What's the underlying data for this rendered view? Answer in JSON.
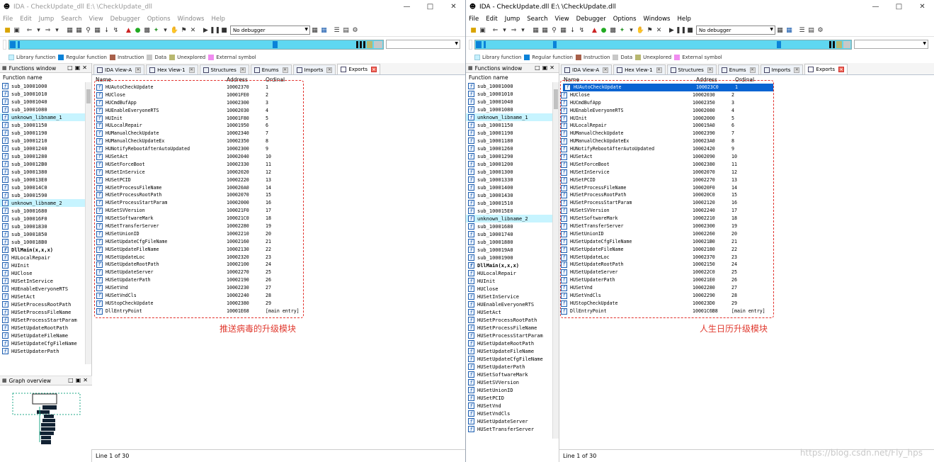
{
  "winA": {
    "title": "IDA - CheckUpdate_dll E:\\        \\CheckUpdate_dll",
    "menu": [
      "File",
      "Edit",
      "Jump",
      "Search",
      "View",
      "Debugger",
      "Options",
      "Windows",
      "Help"
    ],
    "debugger_select": "No debugger",
    "legend": [
      "Library function",
      "Regular function",
      "Instruction",
      "Data",
      "Unexplored",
      "External symbol"
    ],
    "functions_panel_title": "Functions window",
    "functions_header": "Function name",
    "functions": [
      {
        "name": "sub_10001000",
        "kind": "normal"
      },
      {
        "name": "sub_10001010",
        "kind": "normal"
      },
      {
        "name": "sub_10001040",
        "kind": "normal"
      },
      {
        "name": "sub_10001080",
        "kind": "normal"
      },
      {
        "name": "unknown_libname_1",
        "kind": "lib"
      },
      {
        "name": "sub_10001150",
        "kind": "normal"
      },
      {
        "name": "sub_10001190",
        "kind": "normal"
      },
      {
        "name": "sub_10001210",
        "kind": "normal"
      },
      {
        "name": "sub_10001240",
        "kind": "normal"
      },
      {
        "name": "sub_10001280",
        "kind": "normal"
      },
      {
        "name": "sub_100012B0",
        "kind": "normal"
      },
      {
        "name": "sub_10001380",
        "kind": "normal"
      },
      {
        "name": "sub_100013E0",
        "kind": "normal"
      },
      {
        "name": "sub_100014C0",
        "kind": "normal"
      },
      {
        "name": "sub_10001590",
        "kind": "normal"
      },
      {
        "name": "unknown_libname_2",
        "kind": "lib"
      },
      {
        "name": "sub_10001680",
        "kind": "normal"
      },
      {
        "name": "sub_100016F0",
        "kind": "normal"
      },
      {
        "name": "sub_10001830",
        "kind": "normal"
      },
      {
        "name": "sub_10001850",
        "kind": "normal"
      },
      {
        "name": "sub_100018B0",
        "kind": "normal"
      },
      {
        "name": "DllMain(x,x,x)",
        "kind": "bold"
      },
      {
        "name": "HULocalRepair",
        "kind": "normal"
      },
      {
        "name": "HUInit",
        "kind": "normal"
      },
      {
        "name": "HUClose",
        "kind": "normal"
      },
      {
        "name": "HUSetInService",
        "kind": "normal"
      },
      {
        "name": "HUEnableEveryoneRTS",
        "kind": "normal"
      },
      {
        "name": "HUSetAct",
        "kind": "normal"
      },
      {
        "name": "HUSetProcessRootPath",
        "kind": "normal"
      },
      {
        "name": "HUSetProcessFileName",
        "kind": "normal"
      },
      {
        "name": "HUSetProcessStartParam",
        "kind": "normal"
      },
      {
        "name": "HUSetUpdateRootPath",
        "kind": "normal"
      },
      {
        "name": "HUSetUpdateFileName",
        "kind": "normal"
      },
      {
        "name": "HUSetUpdateCfgFileName",
        "kind": "normal"
      },
      {
        "name": "HUSetUpdaterPath",
        "kind": "normal"
      }
    ],
    "graph_panel_title": "Graph overview",
    "tabs": [
      {
        "label": "IDA View-A",
        "active": false
      },
      {
        "label": "Hex View-1",
        "active": false
      },
      {
        "label": "Structures",
        "active": false
      },
      {
        "label": "Enums",
        "active": false
      },
      {
        "label": "Imports",
        "active": false
      },
      {
        "label": "Exports",
        "active": true
      }
    ],
    "exports_headers": {
      "name": "Name",
      "address": "Address",
      "ordinal": "Ordinal"
    },
    "exports": [
      {
        "name": "HUAutoCheckUpdate",
        "address": "10002370",
        "ordinal": "1"
      },
      {
        "name": "HUClose",
        "address": "10001FE0",
        "ordinal": "2"
      },
      {
        "name": "HUCmdBufApp",
        "address": "10002300",
        "ordinal": "3"
      },
      {
        "name": "HUEnableEveryoneRTS",
        "address": "10002030",
        "ordinal": "4"
      },
      {
        "name": "HUInit",
        "address": "10001F80",
        "ordinal": "5"
      },
      {
        "name": "HULocalRepair",
        "address": "10001950",
        "ordinal": "6"
      },
      {
        "name": "HUManualCheckUpdate",
        "address": "10002340",
        "ordinal": "7"
      },
      {
        "name": "HUManualCheckUpdateEx",
        "address": "10002350",
        "ordinal": "8"
      },
      {
        "name": "HUNotifyRebootAfterAutoUpdated",
        "address": "10002300",
        "ordinal": "9"
      },
      {
        "name": "HUSetAct",
        "address": "10002040",
        "ordinal": "10"
      },
      {
        "name": "HUSetForceBoot",
        "address": "10002330",
        "ordinal": "11"
      },
      {
        "name": "HUSetInService",
        "address": "10002020",
        "ordinal": "12"
      },
      {
        "name": "HUSetPCID",
        "address": "10002220",
        "ordinal": "13"
      },
      {
        "name": "HUSetProcessFileName",
        "address": "100020A0",
        "ordinal": "14"
      },
      {
        "name": "HUSetProcessRootPath",
        "address": "10002070",
        "ordinal": "15"
      },
      {
        "name": "HUSetProcessStartParam",
        "address": "10002000",
        "ordinal": "16"
      },
      {
        "name": "HUSetSVVersion",
        "address": "100021F0",
        "ordinal": "17"
      },
      {
        "name": "HUSetSoftwareMark",
        "address": "100021C0",
        "ordinal": "18"
      },
      {
        "name": "HUSetTransferServer",
        "address": "10002280",
        "ordinal": "19"
      },
      {
        "name": "HUSetUnionID",
        "address": "10002210",
        "ordinal": "20"
      },
      {
        "name": "HUSetUpdateCfgFileName",
        "address": "10002160",
        "ordinal": "21"
      },
      {
        "name": "HUSetUpdateFileName",
        "address": "10002130",
        "ordinal": "22"
      },
      {
        "name": "HUSetUpdateLoc",
        "address": "10002320",
        "ordinal": "23"
      },
      {
        "name": "HUSetUpdateRootPath",
        "address": "10002100",
        "ordinal": "24"
      },
      {
        "name": "HUSetUpdateServer",
        "address": "10002270",
        "ordinal": "25"
      },
      {
        "name": "HUSetUpdaterPath",
        "address": "10002190",
        "ordinal": "26"
      },
      {
        "name": "HUSetVnd",
        "address": "10002230",
        "ordinal": "27"
      },
      {
        "name": "HUSetVndCls",
        "address": "10002240",
        "ordinal": "28"
      },
      {
        "name": "HUStopCheckUpdate",
        "address": "10002380",
        "ordinal": "29"
      },
      {
        "name": "DllEntryPoint",
        "address": "10001E68",
        "ordinal": "[main entry]"
      }
    ],
    "annotation": "推送病毒的升级模块",
    "status": "Line 1 of 30"
  },
  "winB": {
    "title": "IDA - CheckUpdate.dll E:\\        \\CheckUpdate.dll",
    "menu": [
      "File",
      "Edit",
      "Jump",
      "Search",
      "View",
      "Debugger",
      "Options",
      "Windows",
      "Help"
    ],
    "debugger_select": "No debugger",
    "legend": [
      "Library function",
      "Regular function",
      "Instruction",
      "Data",
      "Unexplored",
      "External symbol"
    ],
    "functions_panel_title": "Functions window",
    "functions_header": "Function name",
    "functions": [
      {
        "name": "sub_10001000",
        "kind": "normal"
      },
      {
        "name": "sub_10001010",
        "kind": "normal"
      },
      {
        "name": "sub_10001040",
        "kind": "normal"
      },
      {
        "name": "sub_10001080",
        "kind": "normal"
      },
      {
        "name": "unknown_libname_1",
        "kind": "lib"
      },
      {
        "name": "sub_10001150",
        "kind": "normal"
      },
      {
        "name": "sub_10001190",
        "kind": "normal"
      },
      {
        "name": "sub_10001180",
        "kind": "normal"
      },
      {
        "name": "sub_10001260",
        "kind": "normal"
      },
      {
        "name": "sub_10001290",
        "kind": "normal"
      },
      {
        "name": "sub_10001200",
        "kind": "normal"
      },
      {
        "name": "sub_10001300",
        "kind": "normal"
      },
      {
        "name": "sub_10001330",
        "kind": "normal"
      },
      {
        "name": "sub_10001400",
        "kind": "normal"
      },
      {
        "name": "sub_10001430",
        "kind": "normal"
      },
      {
        "name": "sub_10001510",
        "kind": "normal"
      },
      {
        "name": "sub_100015E0",
        "kind": "normal"
      },
      {
        "name": "unknown_libname_2",
        "kind": "lib"
      },
      {
        "name": "sub_10001680",
        "kind": "normal"
      },
      {
        "name": "sub_10001740",
        "kind": "normal"
      },
      {
        "name": "sub_10001880",
        "kind": "normal"
      },
      {
        "name": "sub_100019A0",
        "kind": "normal"
      },
      {
        "name": "sub_10001900",
        "kind": "normal"
      },
      {
        "name": "DllMain(x,x,x)",
        "kind": "bold"
      },
      {
        "name": "HULocalRepair",
        "kind": "normal"
      },
      {
        "name": "HUInit",
        "kind": "normal"
      },
      {
        "name": "HUClose",
        "kind": "normal"
      },
      {
        "name": "HUSetInService",
        "kind": "normal"
      },
      {
        "name": "HUEnableEveryoneRTS",
        "kind": "normal"
      },
      {
        "name": "HUSetAct",
        "kind": "normal"
      },
      {
        "name": "HUSetProcessRootPath",
        "kind": "normal"
      },
      {
        "name": "HUSetProcessFileName",
        "kind": "normal"
      },
      {
        "name": "HUSetProcessStartParam",
        "kind": "normal"
      },
      {
        "name": "HUSetUpdateRootPath",
        "kind": "normal"
      },
      {
        "name": "HUSetUpdateFileName",
        "kind": "normal"
      },
      {
        "name": "HUSetUpdateCfgFileName",
        "kind": "normal"
      },
      {
        "name": "HUSetUpdaterPath",
        "kind": "normal"
      },
      {
        "name": "HUSetSoftwareMark",
        "kind": "normal"
      },
      {
        "name": "HUSetSVVersion",
        "kind": "normal"
      },
      {
        "name": "HUSetUnionID",
        "kind": "normal"
      },
      {
        "name": "HUSetPCID",
        "kind": "normal"
      },
      {
        "name": "HUSetVnd",
        "kind": "normal"
      },
      {
        "name": "HUSetVndCls",
        "kind": "normal"
      },
      {
        "name": "HUSetUpdateServer",
        "kind": "normal"
      },
      {
        "name": "HUSetTransferServer",
        "kind": "normal"
      }
    ],
    "tabs": [
      {
        "label": "IDA View-A",
        "active": false
      },
      {
        "label": "Hex View-1",
        "active": false
      },
      {
        "label": "Structures",
        "active": false
      },
      {
        "label": "Enums",
        "active": false
      },
      {
        "label": "Imports",
        "active": false
      },
      {
        "label": "Exports",
        "active": true
      }
    ],
    "exports_headers": {
      "name": "Name",
      "address": "Address",
      "ordinal": "Ordinal"
    },
    "exports": [
      {
        "name": "HUAutoCheckUpdate",
        "address": "100023C0",
        "ordinal": "1"
      },
      {
        "name": "HUClose",
        "address": "10002030",
        "ordinal": "2"
      },
      {
        "name": "HUCmdBufApp",
        "address": "10002350",
        "ordinal": "3"
      },
      {
        "name": "HUEnableEveryoneRTS",
        "address": "10002080",
        "ordinal": "4"
      },
      {
        "name": "HUInit",
        "address": "10002000",
        "ordinal": "5"
      },
      {
        "name": "HULocalRepair",
        "address": "100019A0",
        "ordinal": "6"
      },
      {
        "name": "HUManualCheckUpdate",
        "address": "10002390",
        "ordinal": "7"
      },
      {
        "name": "HUManualCheckUpdateEx",
        "address": "100023A0",
        "ordinal": "8"
      },
      {
        "name": "HUNotifyRebootAfterAutoUpdated",
        "address": "10002420",
        "ordinal": "9"
      },
      {
        "name": "HUSetAct",
        "address": "10002090",
        "ordinal": "10"
      },
      {
        "name": "HUSetForceBoot",
        "address": "10002380",
        "ordinal": "11"
      },
      {
        "name": "HUSetInService",
        "address": "10002070",
        "ordinal": "12"
      },
      {
        "name": "HUSetPCID",
        "address": "10002270",
        "ordinal": "13"
      },
      {
        "name": "HUSetProcessFileName",
        "address": "100020F0",
        "ordinal": "14"
      },
      {
        "name": "HUSetProcessRootPath",
        "address": "100020C0",
        "ordinal": "15"
      },
      {
        "name": "HUSetProcessStartParam",
        "address": "10002120",
        "ordinal": "16"
      },
      {
        "name": "HUSetSVVersion",
        "address": "10002240",
        "ordinal": "17"
      },
      {
        "name": "HUSetSoftwareMark",
        "address": "10002210",
        "ordinal": "18"
      },
      {
        "name": "HUSetTransferServer",
        "address": "10002300",
        "ordinal": "19"
      },
      {
        "name": "HUSetUnionID",
        "address": "10002260",
        "ordinal": "20"
      },
      {
        "name": "HUSetUpdateCfgFileName",
        "address": "100021B0",
        "ordinal": "21"
      },
      {
        "name": "HUSetUpdateFileName",
        "address": "10002180",
        "ordinal": "22"
      },
      {
        "name": "HUSetUpdateLoc",
        "address": "10002370",
        "ordinal": "23"
      },
      {
        "name": "HUSetUpdateRootPath",
        "address": "10002150",
        "ordinal": "24"
      },
      {
        "name": "HUSetUpdateServer",
        "address": "100022C0",
        "ordinal": "25"
      },
      {
        "name": "HUSetUpdaterPath",
        "address": "100021E0",
        "ordinal": "26"
      },
      {
        "name": "HUSetVnd",
        "address": "10002280",
        "ordinal": "27"
      },
      {
        "name": "HUSetVndCls",
        "address": "10002290",
        "ordinal": "28"
      },
      {
        "name": "HUStopCheckUpdate",
        "address": "100023D0",
        "ordinal": "29"
      },
      {
        "name": "DllEntryPoint",
        "address": "10001C6B8",
        "ordinal": "[main entry]"
      }
    ],
    "annotation": "人生日历升级模块",
    "status": "Line 1 of 30"
  },
  "colors": {
    "library": "#c6f1ff",
    "regular": "#0a82d8",
    "instruction": "#a8604a",
    "data": "#c8c8c8",
    "unexplored": "#b8b870",
    "external": "#f08bf0",
    "annotation_red": "#e03a2f",
    "selection": "#0a64d2"
  },
  "watermark": "https://blog.csdn.net/Fly_hps"
}
